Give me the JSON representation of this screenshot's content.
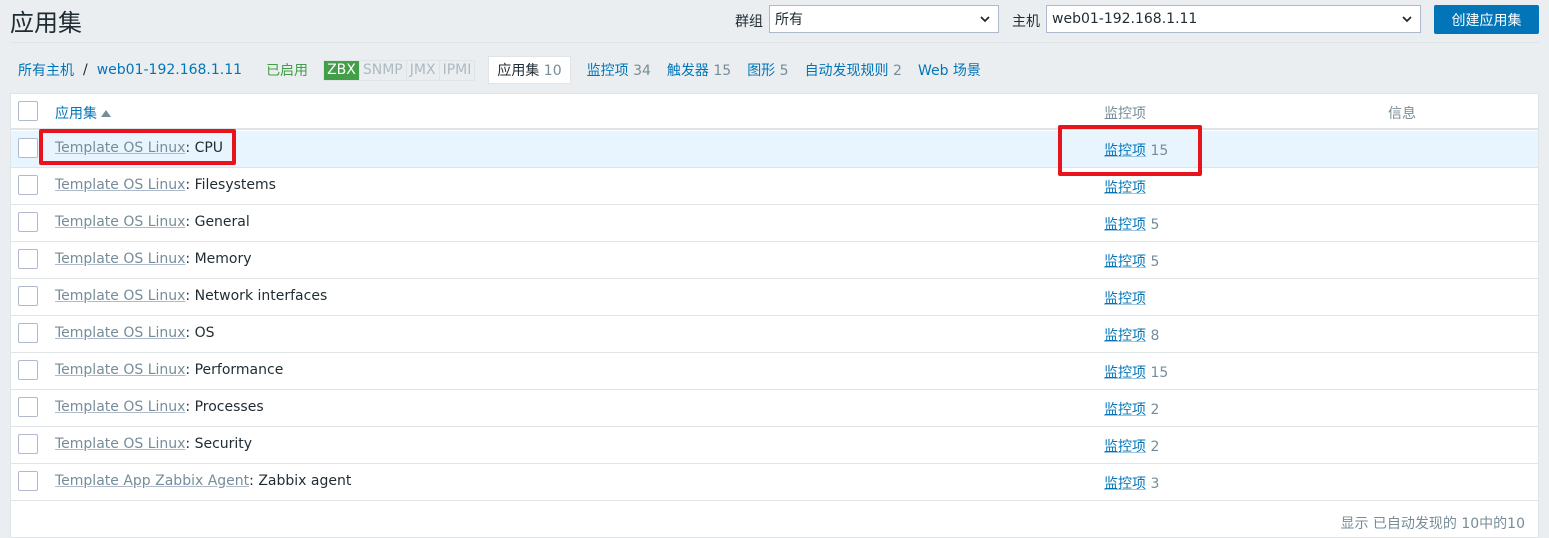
{
  "header": {
    "title": "应用集",
    "group_label": "群组",
    "group_value": "所有",
    "host_label": "主机",
    "host_value": "web01-192.168.1.11",
    "create_button": "创建应用集"
  },
  "nav": {
    "all_hosts": "所有主机",
    "separator": "/",
    "host": "web01-192.168.1.11",
    "status": "已启用",
    "availability": [
      "ZBX",
      "SNMP",
      "JMX",
      "IPMI"
    ],
    "tabs": [
      {
        "label": "应用集",
        "count": "10"
      },
      {
        "label": "监控项",
        "count": "34"
      },
      {
        "label": "触发器",
        "count": "15"
      },
      {
        "label": "图形",
        "count": "5"
      },
      {
        "label": "自动发现规则",
        "count": "2"
      },
      {
        "label": "Web 场景",
        "count": ""
      }
    ]
  },
  "table": {
    "columns": [
      "应用集",
      "监控项",
      "信息"
    ],
    "rows": [
      {
        "template": "Template OS Linux",
        "name": "CPU",
        "items_label": "监控项",
        "items_count": "15"
      },
      {
        "template": "Template OS Linux",
        "name": "Filesystems",
        "items_label": "监控项",
        "items_count": ""
      },
      {
        "template": "Template OS Linux",
        "name": "General",
        "items_label": "监控项",
        "items_count": "5"
      },
      {
        "template": "Template OS Linux",
        "name": "Memory",
        "items_label": "监控项",
        "items_count": "5"
      },
      {
        "template": "Template OS Linux",
        "name": "Network interfaces",
        "items_label": "监控项",
        "items_count": ""
      },
      {
        "template": "Template OS Linux",
        "name": "OS",
        "items_label": "监控项",
        "items_count": "8"
      },
      {
        "template": "Template OS Linux",
        "name": "Performance",
        "items_label": "监控项",
        "items_count": "15"
      },
      {
        "template": "Template OS Linux",
        "name": "Processes",
        "items_label": "监控项",
        "items_count": "2"
      },
      {
        "template": "Template OS Linux",
        "name": "Security",
        "items_label": "监控项",
        "items_count": "2"
      },
      {
        "template": "Template App Zabbix Agent",
        "name": "Zabbix agent",
        "items_label": "监控项",
        "items_count": "3"
      }
    ],
    "footer": "显示 已自动发现的 10中的10"
  },
  "colors": {
    "primary": "#0275b8",
    "enabled": "#429e47",
    "highlight": "#e8141d"
  }
}
